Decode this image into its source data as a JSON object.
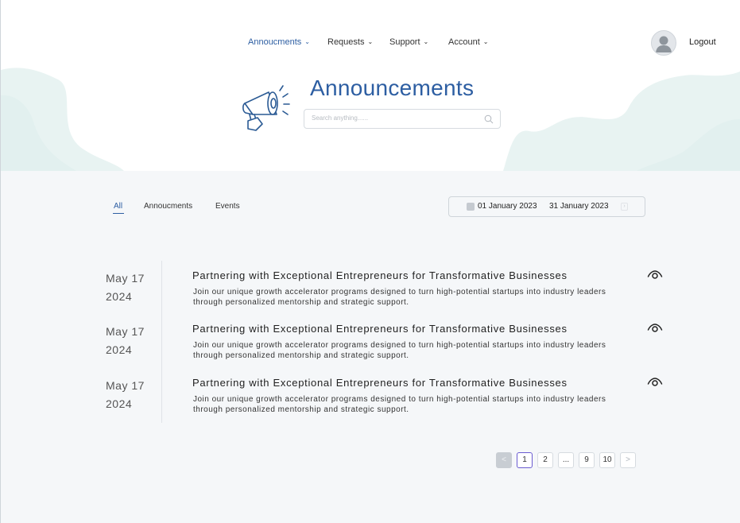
{
  "nav": {
    "items": [
      {
        "label": "Annoucments",
        "active": true
      },
      {
        "label": "Requests",
        "active": false
      },
      {
        "label": "Support",
        "active": false
      },
      {
        "label": "Account",
        "active": false
      }
    ],
    "logout_label": "Logout",
    "avatar_icon": "user-avatar-icon"
  },
  "header": {
    "title": "Announcements",
    "icon": "megaphone-icon",
    "search": {
      "placeholder": "Search anything......",
      "value": ""
    }
  },
  "filters": {
    "tabs": [
      {
        "label": "All",
        "active": true
      },
      {
        "label": "Annoucments",
        "active": false
      },
      {
        "label": "Events",
        "active": false
      }
    ],
    "date_range": {
      "start": "01 January 2023",
      "end": "31 January 2023"
    }
  },
  "announcements": [
    {
      "date_md": "May 17",
      "date_year": "2024",
      "title": "Partnering with Exceptional Entrepreneurs for Transformative Businesses",
      "description": "Join our unique growth accelerator programs designed to turn high-potential startups into industry leaders through personalized mentorship and strategic support."
    },
    {
      "date_md": "May 17",
      "date_year": "2024",
      "title": "Partnering with Exceptional Entrepreneurs for Transformative Businesses",
      "description": "Join our unique growth accelerator programs designed to turn high-potential startups into industry leaders through personalized mentorship and strategic support."
    },
    {
      "date_md": "May 17",
      "date_year": "2024",
      "title": "Partnering with Exceptional Entrepreneurs for Transformative Businesses",
      "description": "Join our unique growth accelerator programs designed to turn high-potential startups into industry leaders through personalized mentorship and strategic support."
    }
  ],
  "pagination": {
    "prev": "<",
    "pages": [
      "1",
      "2",
      "...",
      "9",
      "10"
    ],
    "current": "1",
    "next": ">"
  },
  "colors": {
    "accent": "#2d5ea2",
    "wave": "#e6f2f1",
    "background": "#f5f7f9",
    "current_page_border": "#6a5bd1"
  }
}
